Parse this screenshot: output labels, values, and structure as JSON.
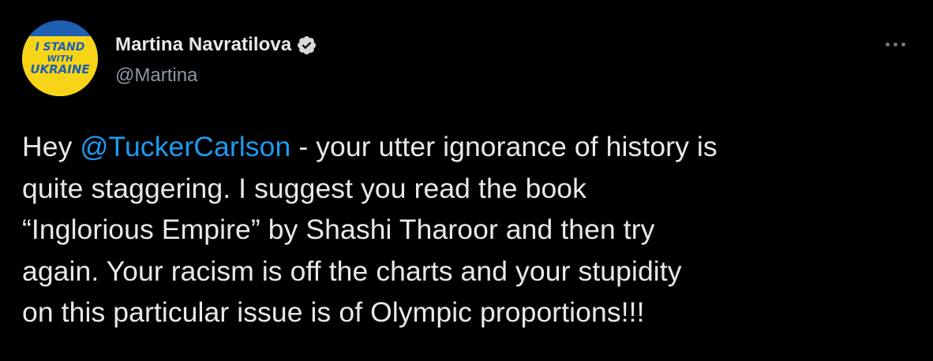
{
  "author": {
    "display_name": "Martina Navratilova",
    "handle": "@Martina",
    "verified": true,
    "avatar": {
      "line1": "I STAND",
      "line2": "WITH",
      "line3": "UKRAINE",
      "colors": {
        "top": "#1e5fb4",
        "bottom": "#f7d417",
        "text": "#1e5fb4"
      }
    }
  },
  "more_menu_icon": "more-horizontal-icon",
  "tweet": {
    "lines": [
      {
        "before": "Hey ",
        "mention": "@TuckerCarlson",
        "after": " - your utter ignorance of history is"
      },
      {
        "text": "quite staggering. I suggest you read the book"
      },
      {
        "text": "“Inglorious Empire” by Shashi Tharoor and then try"
      },
      {
        "text": "again. Your racism is off the charts and your stupidity"
      },
      {
        "text": "on this particular issue is of Olympic proportions!!!"
      }
    ]
  },
  "colors": {
    "background": "#000000",
    "text": "#e7e9ea",
    "secondary": "#8b98a5",
    "accent": "#1d9bf0",
    "verified_badge": "#d9d9d9"
  }
}
